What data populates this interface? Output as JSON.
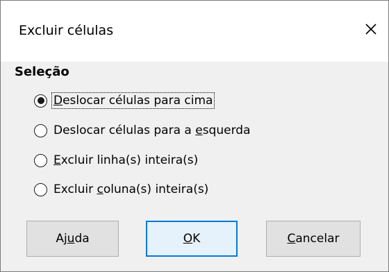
{
  "dialog": {
    "title": "Excluir células",
    "close_icon": "close-icon"
  },
  "selection": {
    "heading": "Seleção",
    "options": [
      {
        "pre": "",
        "u": "D",
        "post": "eslocar células para cima",
        "selected": true
      },
      {
        "pre": "Deslocar células para a ",
        "u": "e",
        "post": "squerda",
        "selected": false
      },
      {
        "pre": "",
        "u": "E",
        "post": "xcluir linha(s) inteira(s)",
        "selected": false
      },
      {
        "pre": "Excluir ",
        "u": "c",
        "post": "oluna(s) inteira(s)",
        "selected": false
      }
    ]
  },
  "buttons": {
    "help": {
      "pre": "Aj",
      "u": "u",
      "post": "da"
    },
    "ok": {
      "pre": "",
      "u": "O",
      "post": "K"
    },
    "cancel": {
      "pre": "",
      "u": "C",
      "post": "ancelar"
    }
  },
  "colors": {
    "accent": "#0078d7",
    "dialog_bg": "#f0f0f0"
  }
}
